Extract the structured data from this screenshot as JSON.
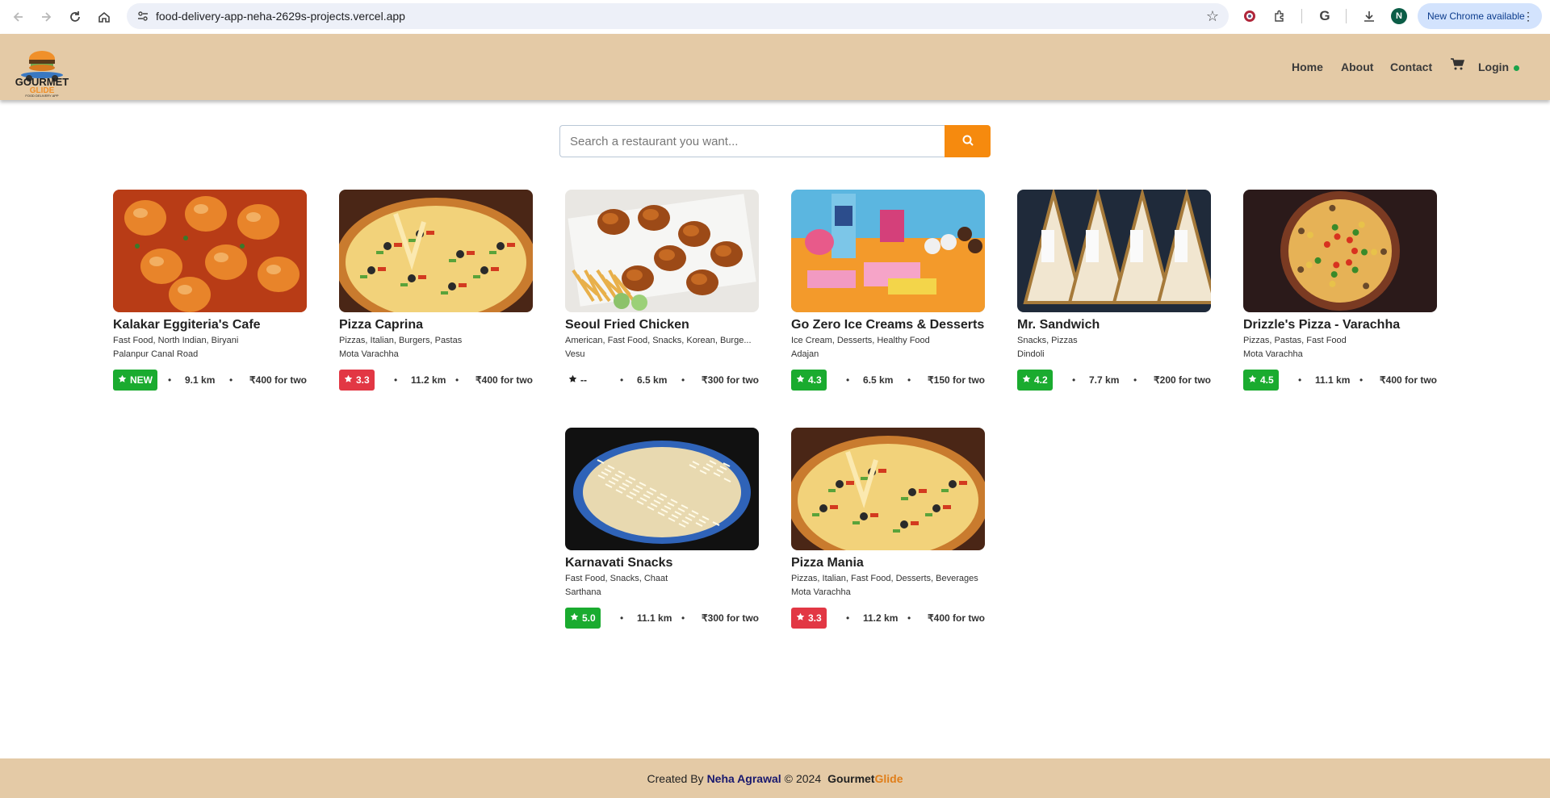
{
  "browser": {
    "url": "food-delivery-app-neha-2629s-projects.vercel.app",
    "profile_initial": "N",
    "update_label": "New Chrome available"
  },
  "header": {
    "logo_text_line1": "GOURMET",
    "logo_text_line2": "GLIDE",
    "logo_tagline": "FOOD DELIVERY APP",
    "nav": {
      "home": "Home",
      "about": "About",
      "contact": "Contact",
      "login": "Login"
    }
  },
  "search": {
    "placeholder": "Search a restaurant you want..."
  },
  "restaurants": [
    {
      "name": "Kalakar Eggiteria's Cafe",
      "cuisines": "Fast Food, North Indian, Biryani",
      "area": "Palanpur Canal Road",
      "rating": "NEW",
      "rating_color": "green",
      "distance": "9.1 km",
      "cost": "₹400 for two",
      "image": "egg-curry"
    },
    {
      "name": "Pizza Caprina",
      "cuisines": "Pizzas, Italian, Burgers, Pastas",
      "area": "Mota Varachha",
      "rating": "3.3",
      "rating_color": "red",
      "distance": "11.2 km",
      "cost": "₹400 for two",
      "image": "cheese-pizza"
    },
    {
      "name": "Seoul Fried Chicken",
      "cuisines": "American, Fast Food, Snacks, Korean, Burge...",
      "area": "Vesu",
      "rating": "--",
      "rating_color": "plain",
      "distance": "6.5 km",
      "cost": "₹300 for two",
      "image": "fried-chicken"
    },
    {
      "name": "Go Zero Ice Creams & Desserts",
      "cuisines": "Ice Cream, Desserts, Healthy Food",
      "area": "Adajan",
      "rating": "4.3",
      "rating_color": "green",
      "distance": "6.5 km",
      "cost": "₹150 for two",
      "image": "ice-creams"
    },
    {
      "name": "Mr. Sandwich",
      "cuisines": "Snacks, Pizzas",
      "area": "Dindoli",
      "rating": "4.2",
      "rating_color": "green",
      "distance": "7.7 km",
      "cost": "₹200 for two",
      "image": "sandwich"
    },
    {
      "name": "Drizzle's Pizza - Varachha",
      "cuisines": "Pizzas, Pastas, Fast Food",
      "area": "Mota Varachha",
      "rating": "4.5",
      "rating_color": "green",
      "distance": "11.1 km",
      "cost": "₹400 for two",
      "image": "veg-pizza"
    },
    {
      "name": "Karnavati Snacks",
      "cuisines": "Fast Food, Snacks, Chaat",
      "area": "Sarthana",
      "rating": "5.0",
      "rating_color": "green",
      "distance": "11.1 km",
      "cost": "₹300 for two",
      "image": "cheese-dosa"
    },
    {
      "name": "Pizza Mania",
      "cuisines": "Pizzas, Italian, Fast Food, Desserts, Beverages",
      "area": "Mota Varachha",
      "rating": "3.3",
      "rating_color": "red",
      "distance": "11.2 km",
      "cost": "₹400 for two",
      "image": "cheese-pizza"
    }
  ],
  "footer": {
    "created_by": "Created By",
    "author": "Neha Agrawal",
    "copyright_symbol": "©",
    "year": "2024",
    "brand_part1": "Gourmet",
    "brand_part2": "Glide"
  },
  "colors": {
    "header_bg": "#e4caa6",
    "accent_orange": "#f68a0e",
    "rating_green": "#1aab2f",
    "rating_red": "#e23744"
  }
}
